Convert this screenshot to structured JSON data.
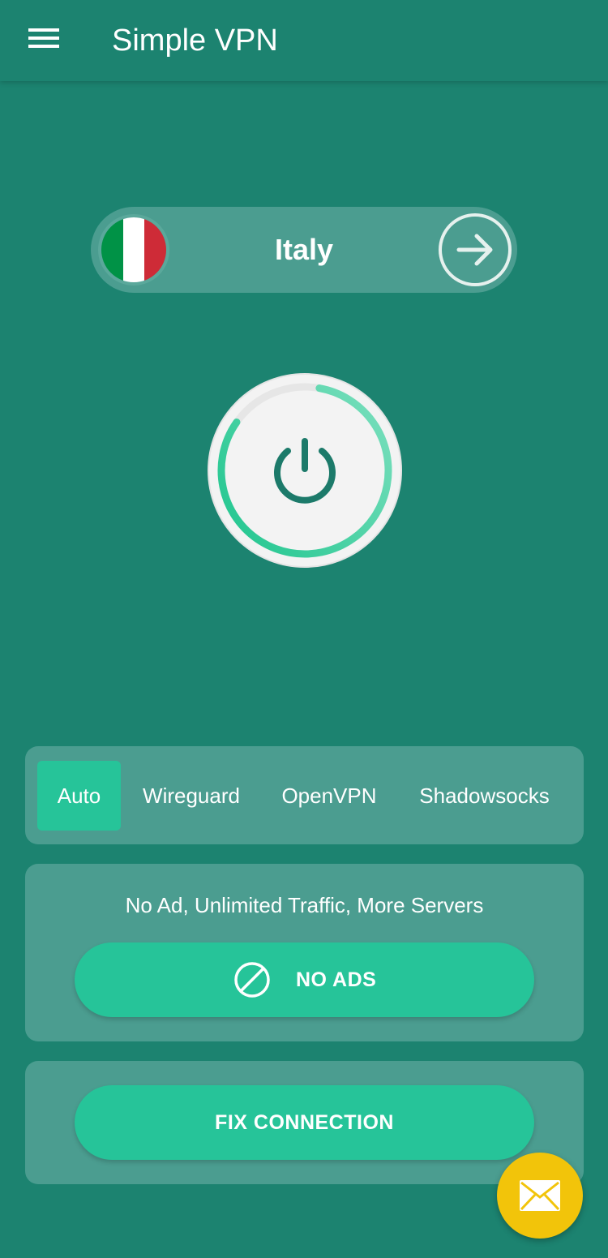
{
  "app": {
    "title": "Simple VPN"
  },
  "location": {
    "country": "Italy",
    "flag_colors": [
      "#009246",
      "#ffffff",
      "#ce2b37"
    ]
  },
  "connection": {
    "progress": 0.82
  },
  "protocols": {
    "items": [
      "Auto",
      "Wireguard",
      "OpenVPN",
      "Shadowsocks"
    ],
    "selected": "Auto"
  },
  "promo": {
    "text": "No Ad, Unlimited Traffic, More Servers",
    "button_label": "NO ADS"
  },
  "fix": {
    "button_label": "FIX CONNECTION"
  },
  "colors": {
    "background": "#1c8370",
    "card": "#4b9d90",
    "accent": "#26c499",
    "fab": "#f2c40a",
    "icon_dark": "#1c7a6a"
  },
  "icons": {
    "menu": "menu-icon",
    "next": "arrow-right-icon",
    "power": "power-icon",
    "no_ads": "block-icon",
    "mail": "mail-icon"
  }
}
